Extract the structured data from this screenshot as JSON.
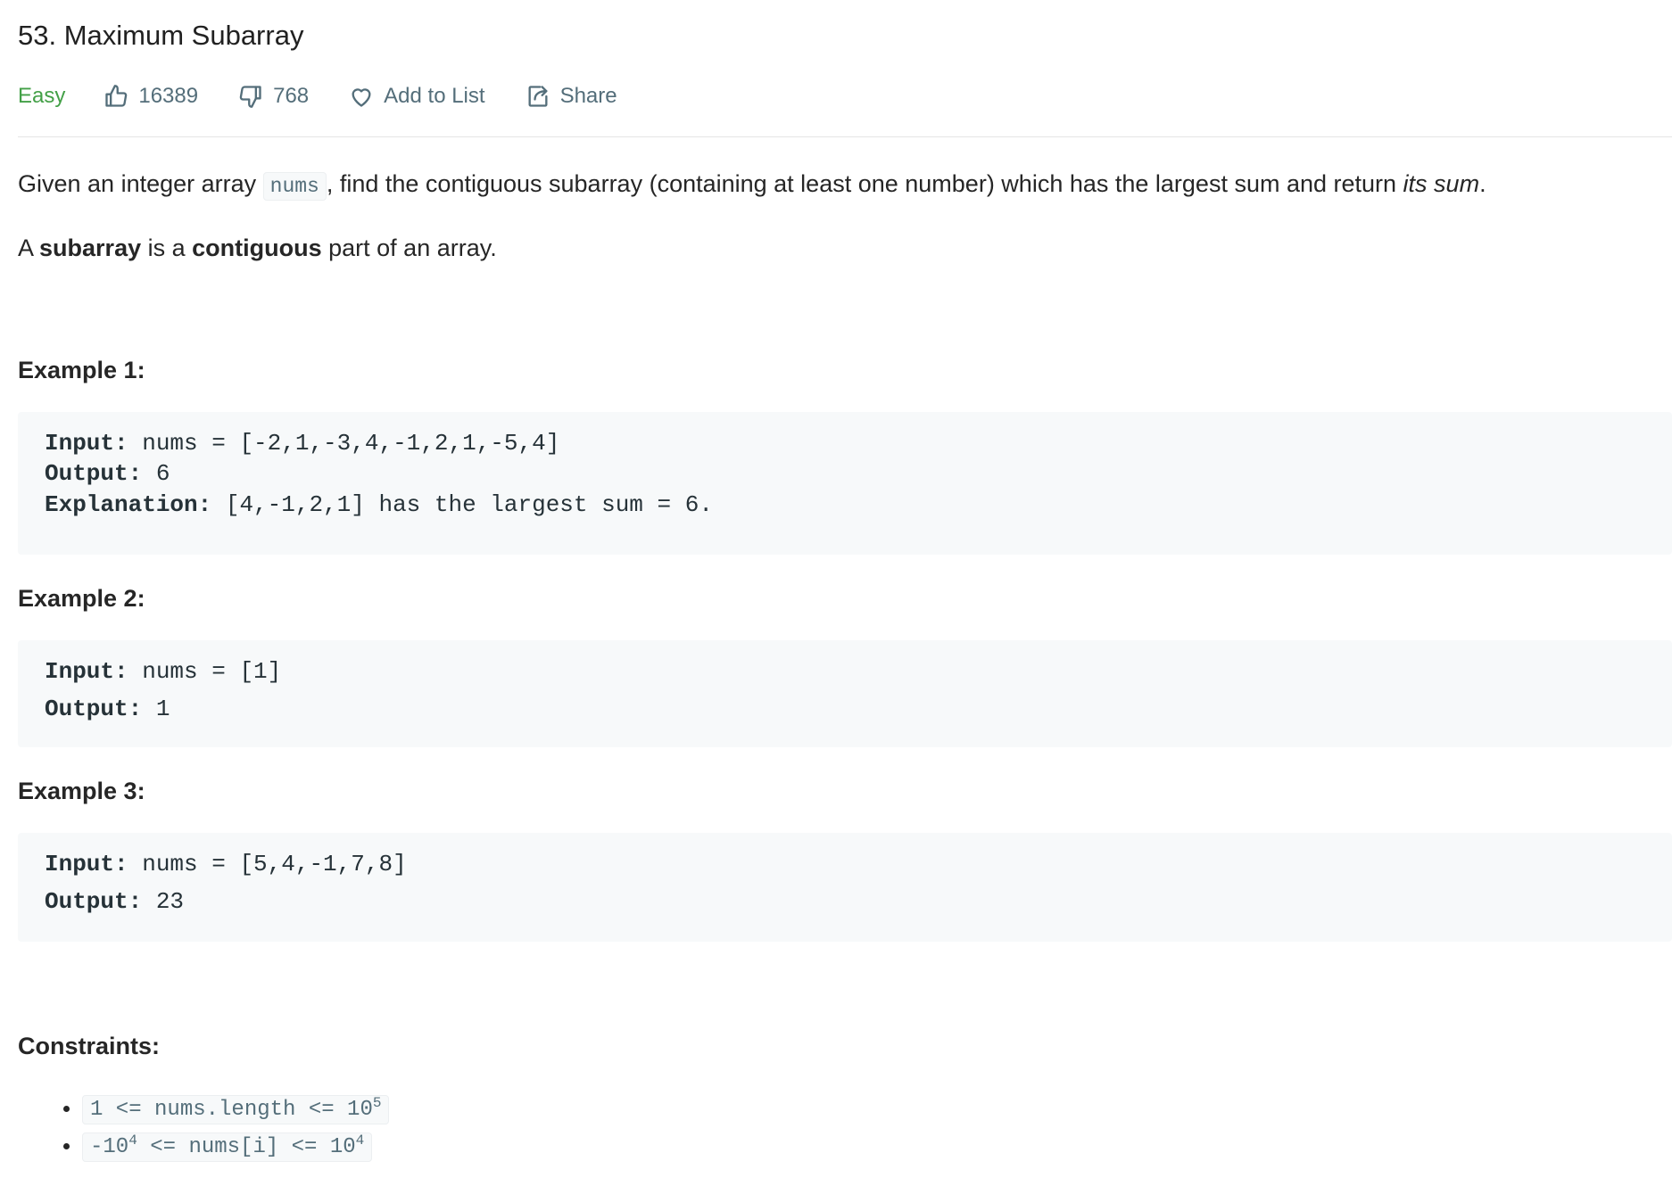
{
  "problem": {
    "title": "53. Maximum Subarray",
    "difficulty": "Easy",
    "likes": "16389",
    "dislikes": "768",
    "add_to_list": "Add to List",
    "share": "Share",
    "colors": {
      "difficulty": "#43a047",
      "meta_text": "#546e7a",
      "code_bg": "#f7f9fa"
    }
  },
  "description": {
    "p1_before": "Given an integer array ",
    "p1_code": "nums",
    "p1_after": ", find the contiguous subarray (containing at least one number) which has the largest sum and return ",
    "p1_em": "its sum",
    "p1_end": ".",
    "p2_a": "A ",
    "p2_b": "subarray",
    "p2_c": " is a ",
    "p2_d": "contiguous",
    "p2_e": " part of an array."
  },
  "examples": [
    {
      "heading": "Example 1:",
      "input_label": "Input:",
      "input_value": " nums = [-2,1,-3,4,-1,2,1,-5,4]",
      "output_label": "Output:",
      "output_value": " 6",
      "explanation_label": "Explanation:",
      "explanation_value": " [4,-1,2,1] has the largest sum = 6."
    },
    {
      "heading": "Example 2:",
      "input_label": "Input:",
      "input_value": " nums = [1]",
      "output_label": "Output:",
      "output_value": " 1"
    },
    {
      "heading": "Example 3:",
      "input_label": "Input:",
      "input_value": " nums = [5,4,-1,7,8]",
      "output_label": "Output:",
      "output_value": " 23"
    }
  ],
  "constraints": {
    "heading": "Constraints:",
    "c1_main": "1 <= nums.length <= 10",
    "c1_exp": "5",
    "c2_a": "-10",
    "c2_exp1": "4",
    "c2_b": " <= nums[i] <= 10",
    "c2_exp2": "4"
  },
  "icons": [
    "thumbs-up-icon",
    "thumbs-down-icon",
    "heart-icon",
    "share-icon"
  ]
}
